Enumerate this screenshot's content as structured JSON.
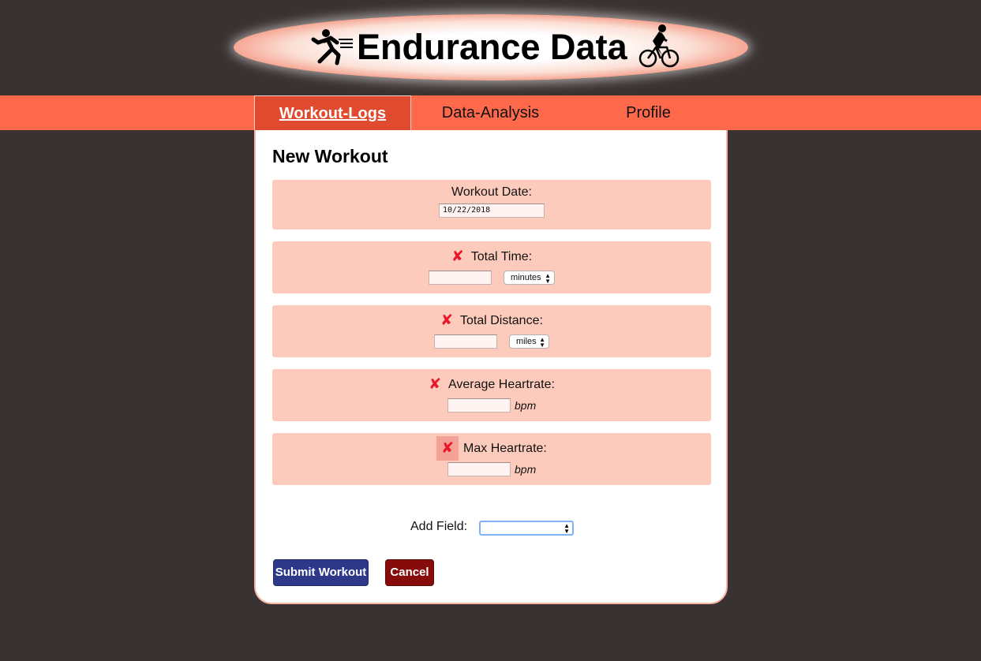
{
  "header": {
    "title": "Endurance Data",
    "left_icon": "runner-icon",
    "right_icon": "cyclist-icon"
  },
  "nav": {
    "tabs": [
      {
        "label": "Workout-Logs",
        "active": true
      },
      {
        "label": "Data-Analysis",
        "active": false
      },
      {
        "label": "Profile",
        "active": false
      }
    ]
  },
  "form": {
    "title": "New Workout",
    "fields": {
      "workout_date": {
        "label": "Workout Date:",
        "value": "10/22/2018"
      },
      "total_time": {
        "label": "Total Time:",
        "value": "",
        "unit_select": "minutes"
      },
      "total_distance": {
        "label": "Total Distance:",
        "value": "",
        "unit_select": "miles"
      },
      "average_heartrate": {
        "label": "Average Heartrate:",
        "value": "",
        "unit": "bpm"
      },
      "max_heartrate": {
        "label": "Max Heartrate:",
        "value": "",
        "unit": "bpm"
      }
    },
    "remove_icon_glyph": "✘",
    "add_field": {
      "label": "Add Field:",
      "selected": ""
    },
    "submit_label": "Submit Workout",
    "cancel_label": "Cancel"
  },
  "colors": {
    "background": "#3a3232",
    "nav": "#ff694b",
    "nav_active": "#e04b30",
    "field_box": "#fdcbbb",
    "remove_icon": "#e8182a",
    "submit_button": "#2e3889",
    "cancel_button": "#860c0c"
  }
}
